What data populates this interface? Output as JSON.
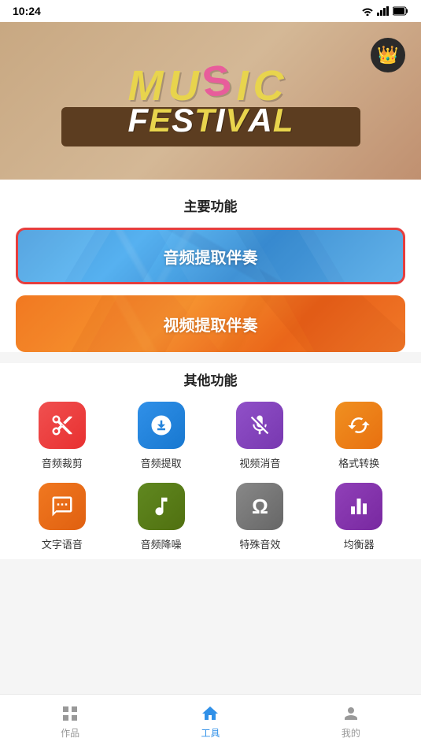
{
  "statusBar": {
    "time": "10:24"
  },
  "banner": {
    "title": "MUSIC FESTIVAL",
    "music_letters": [
      "M",
      "U",
      "S",
      "I",
      "C"
    ],
    "festival_letters": [
      "F",
      "E",
      "S",
      "T",
      "I",
      "V",
      "A",
      "L"
    ]
  },
  "primaryFunctions": {
    "sectionTitle": "主要功能",
    "audioButton": "音频提取伴奏",
    "videoButton": "视频提取伴奏"
  },
  "otherFunctions": {
    "sectionTitle": "其他功能",
    "items": [
      {
        "label": "音频裁剪",
        "icon": "scissors-icon",
        "bg": "bg-red"
      },
      {
        "label": "音频提取",
        "icon": "download-icon",
        "bg": "bg-blue"
      },
      {
        "label": "视频消音",
        "icon": "mic-off-icon",
        "bg": "bg-purple"
      },
      {
        "label": "格式转换",
        "icon": "convert-icon",
        "bg": "bg-orange"
      },
      {
        "label": "文字语音",
        "icon": "text-speech-icon",
        "bg": "bg-orange2"
      },
      {
        "label": "音频降噪",
        "icon": "noise-icon",
        "bg": "bg-green"
      },
      {
        "label": "特殊音效",
        "icon": "omega-icon",
        "bg": "bg-gray"
      },
      {
        "label": "均衡器",
        "icon": "equalizer-icon",
        "bg": "bg-purple2"
      }
    ]
  },
  "bottomNav": {
    "items": [
      {
        "label": "作品",
        "icon": "grid-icon",
        "active": false
      },
      {
        "label": "工具",
        "icon": "home-icon",
        "active": true
      },
      {
        "label": "我的",
        "icon": "user-icon",
        "active": false
      }
    ]
  }
}
